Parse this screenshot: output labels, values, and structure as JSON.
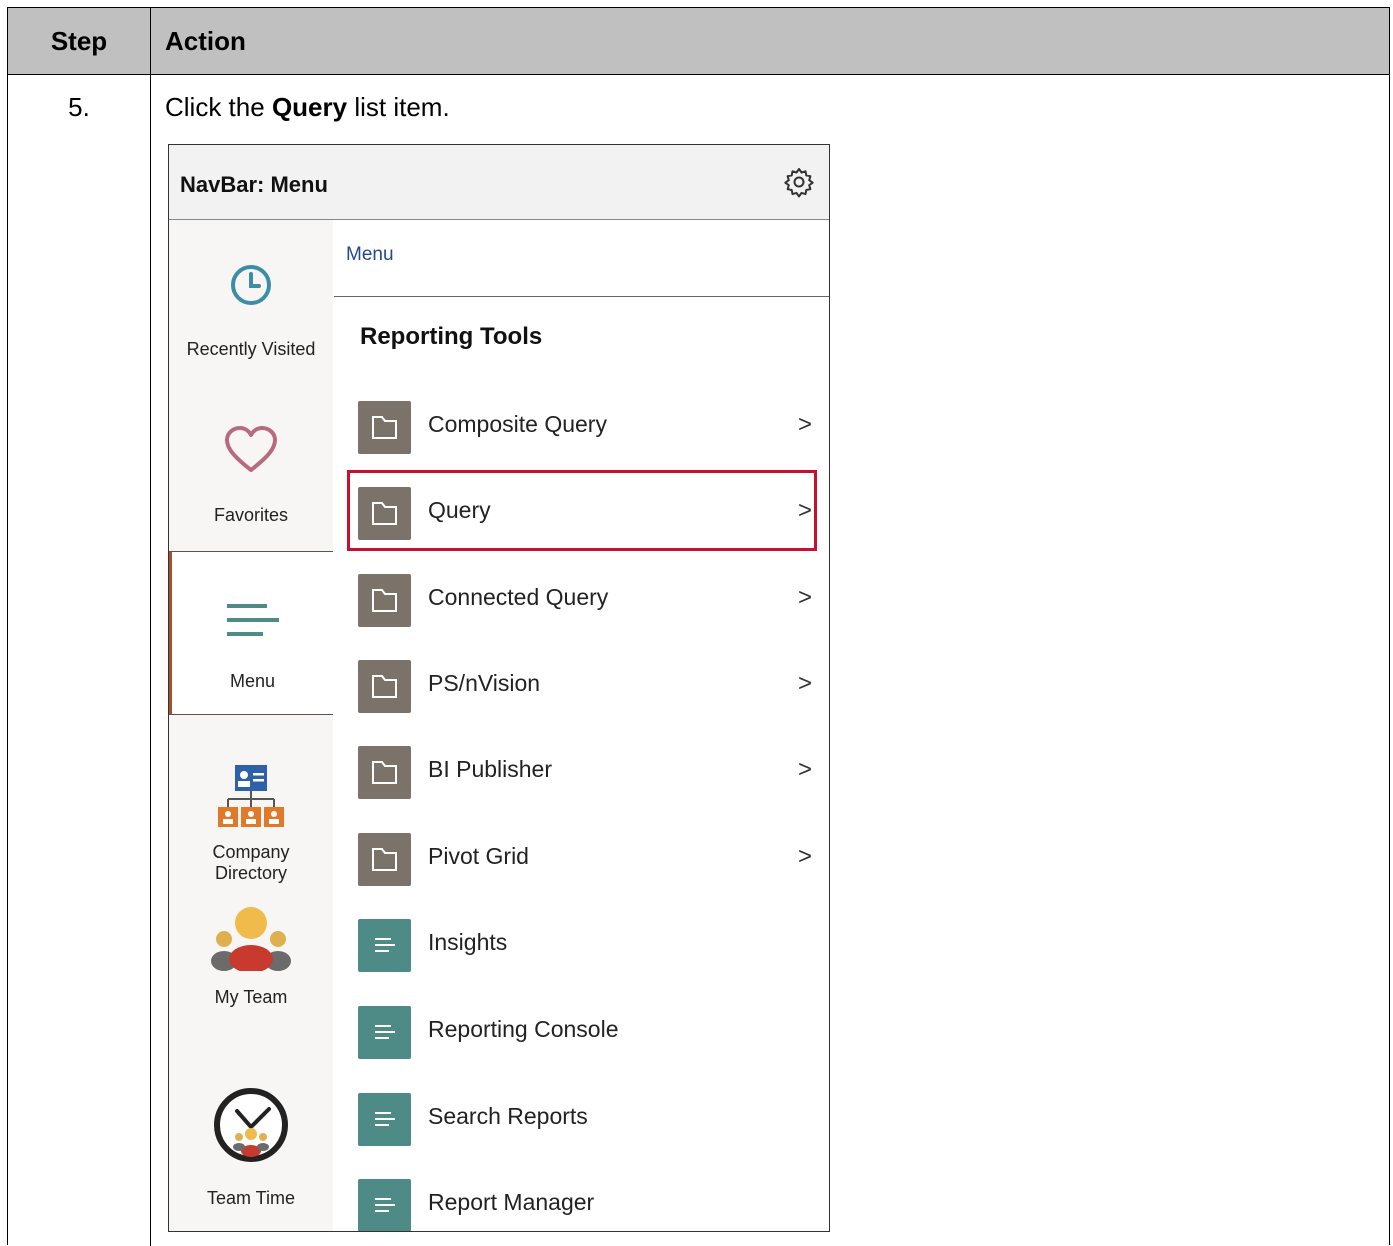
{
  "table": {
    "header_step": "Step",
    "header_action": "Action",
    "step_number": "5.",
    "instruction_prefix": "Click the",
    "instruction_bold": "Query",
    "instruction_suffix": "list item."
  },
  "panel": {
    "title": "NavBar: Menu",
    "breadcrumb": "Menu",
    "section_title": "Reporting Tools",
    "sidebar": [
      {
        "label": "Recently Visited",
        "icon": "clock-icon"
      },
      {
        "label": "Favorites",
        "icon": "heart-icon"
      },
      {
        "label": "Menu",
        "icon": "menu-lines-icon",
        "active": true
      },
      {
        "label_line1": "Company",
        "label_line2": "Directory",
        "icon": "org-chart-icon"
      },
      {
        "label": "My Team",
        "icon": "team-people-icon"
      },
      {
        "label": "Team Time",
        "icon": "team-clock-icon"
      }
    ],
    "items": [
      {
        "label": "Composite Query",
        "type": "folder",
        "chevron": ">"
      },
      {
        "label": "Query",
        "type": "folder",
        "chevron": ">",
        "highlighted": true
      },
      {
        "label": "Connected Query",
        "type": "folder",
        "chevron": ">"
      },
      {
        "label": "PS/nVision",
        "type": "folder",
        "chevron": ">"
      },
      {
        "label": "BI Publisher",
        "type": "folder",
        "chevron": ">"
      },
      {
        "label": "Pivot Grid",
        "type": "folder",
        "chevron": ">"
      },
      {
        "label": "Insights",
        "type": "document"
      },
      {
        "label": "Reporting Console",
        "type": "document"
      },
      {
        "label": "Search Reports",
        "type": "document"
      },
      {
        "label": "Report Manager",
        "type": "document"
      }
    ]
  },
  "colors": {
    "header_bg": "#c0c0c0",
    "folder_tile": "#7b736a",
    "doc_tile": "#4e8a86",
    "highlight": "#c8102e",
    "breadcrumb": "#224a8c"
  }
}
